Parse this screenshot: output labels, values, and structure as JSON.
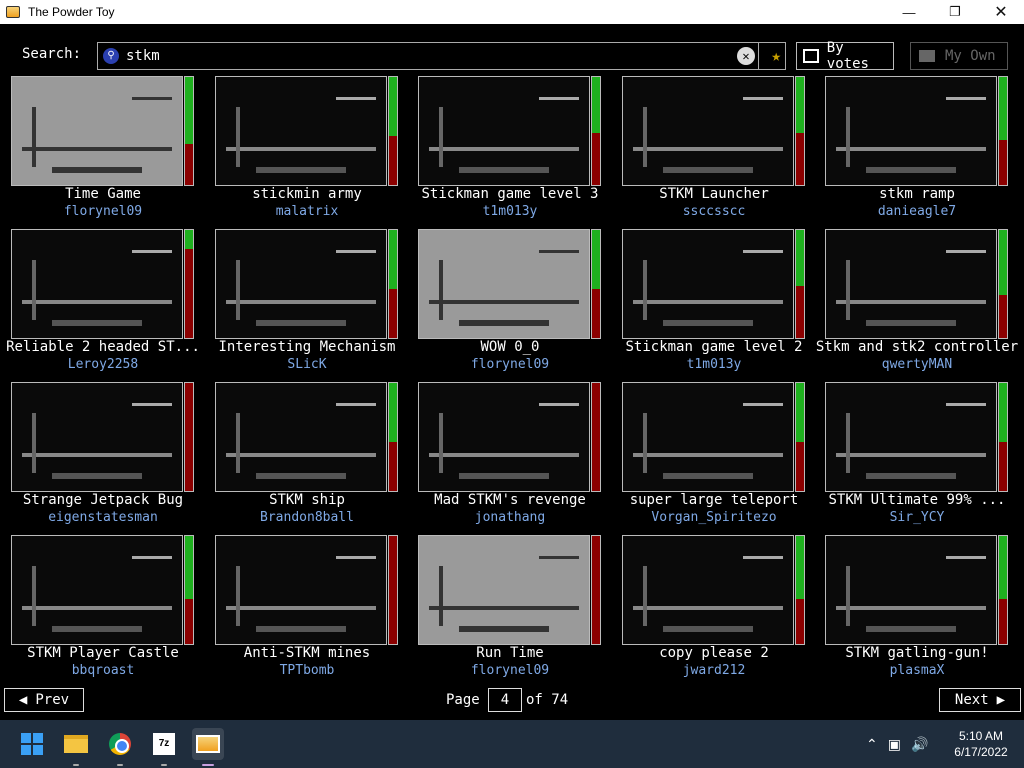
{
  "window": {
    "title": "The Powder Toy"
  },
  "search": {
    "label": "Search:",
    "query": "stkm",
    "sort_label": "By votes",
    "myown_label": "My Own"
  },
  "saves": [
    {
      "name": "Time Game",
      "author": "florynel09",
      "score": 0.62,
      "theme": "gray"
    },
    {
      "name": "stickmin army",
      "author": "malatrix",
      "score": 0.55,
      "theme": "dark"
    },
    {
      "name": "Stickman game level 3",
      "author": "t1m013y",
      "score": 0.52,
      "theme": "dark"
    },
    {
      "name": "STKM Launcher",
      "author": "ssccsscc",
      "score": 0.52,
      "theme": "dark"
    },
    {
      "name": "stkm ramp",
      "author": "danieagle7",
      "score": 0.58,
      "theme": "dark"
    },
    {
      "name": "Reliable 2 headed ST...",
      "author": "Leroy2258",
      "score": 0.18,
      "theme": "dark"
    },
    {
      "name": "Interesting Mechanism",
      "author": "SLicK",
      "score": 0.55,
      "theme": "dark"
    },
    {
      "name": "WOW 0_0",
      "author": "florynel09",
      "score": 0.55,
      "theme": "gray"
    },
    {
      "name": "Stickman game level 2",
      "author": "t1m013y",
      "score": 0.52,
      "theme": "dark"
    },
    {
      "name": "Stkm and stk2 controller",
      "author": "qwertyMAN",
      "score": 0.6,
      "theme": "dark"
    },
    {
      "name": "Strange Jetpack Bug",
      "author": "eigenstatesman",
      "score": 0.0,
      "theme": "dark"
    },
    {
      "name": "STKM ship",
      "author": "Brandon8ball",
      "score": 0.55,
      "theme": "dark"
    },
    {
      "name": "Mad STKM's revenge",
      "author": "jonathang",
      "score": 0.0,
      "theme": "dark"
    },
    {
      "name": "super large teleport",
      "author": "Vorgan_Spiritezo",
      "score": 0.55,
      "theme": "dark"
    },
    {
      "name": "STKM Ultimate 99% ...",
      "author": "Sir_YCY",
      "score": 0.55,
      "theme": "dark"
    },
    {
      "name": "STKM Player Castle",
      "author": "bbqroast",
      "score": 0.58,
      "theme": "dark"
    },
    {
      "name": "Anti-STKM mines",
      "author": "TPTbomb",
      "score": 0.0,
      "theme": "dark"
    },
    {
      "name": "Run Time",
      "author": "florynel09",
      "score": 0.0,
      "theme": "gray"
    },
    {
      "name": "copy please 2",
      "author": "jward212",
      "score": 0.58,
      "theme": "dark"
    },
    {
      "name": "STKM gatling-gun!",
      "author": "plasmaX",
      "score": 0.58,
      "theme": "dark"
    }
  ],
  "pager": {
    "prev_label": "Prev",
    "next_label": "Next",
    "page_label": "Page",
    "current_page": "4",
    "of_label": "of 74"
  },
  "taskbar": {
    "time": "5:10 AM",
    "date": "6/17/2022"
  },
  "colors": {
    "vote_up": "#1fb01f",
    "vote_down": "#8b0000",
    "author": "#7fa9e6"
  }
}
